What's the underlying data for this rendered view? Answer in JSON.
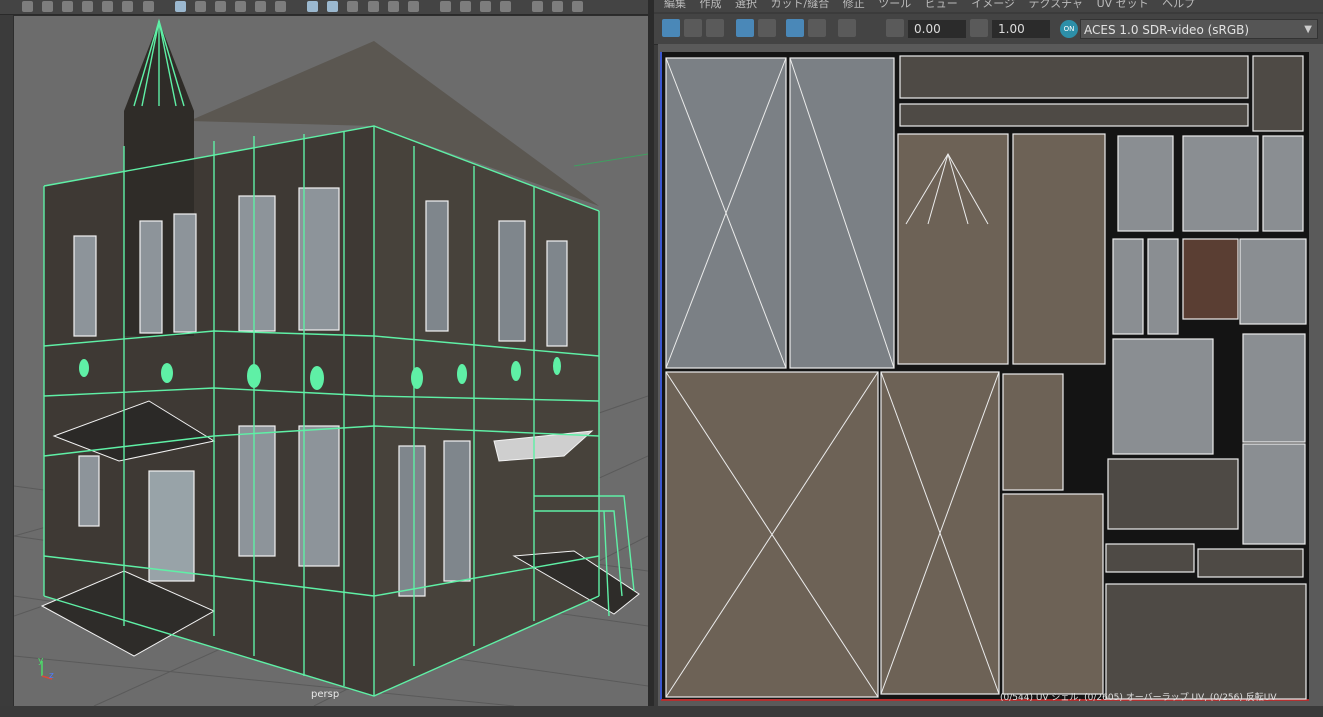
{
  "viewport3d": {
    "camera_label": "persp",
    "axis_y": "y",
    "axis_z": "z"
  },
  "uv_editor": {
    "menu": [
      "編集",
      "作成",
      "選択",
      "カット/縫合",
      "修正",
      "ツール",
      "ビュー",
      "イメージ",
      "テクスチャ",
      "UV セット",
      "ヘルプ"
    ],
    "exposure_value": "0.00",
    "gamma_value": "1.00",
    "color_space_badge": "ON",
    "color_space": "ACES 1.0 SDR-video (sRGB)",
    "status": "(0/544) UV シェル, (0/2605) オーバーラップ UV, (0/256) 反転UV"
  },
  "colors": {
    "wire_selected": "#5ff0a6",
    "wire_white": "#f2f2f2",
    "grid": "#5a5a5a",
    "wall": "#3e3934"
  }
}
